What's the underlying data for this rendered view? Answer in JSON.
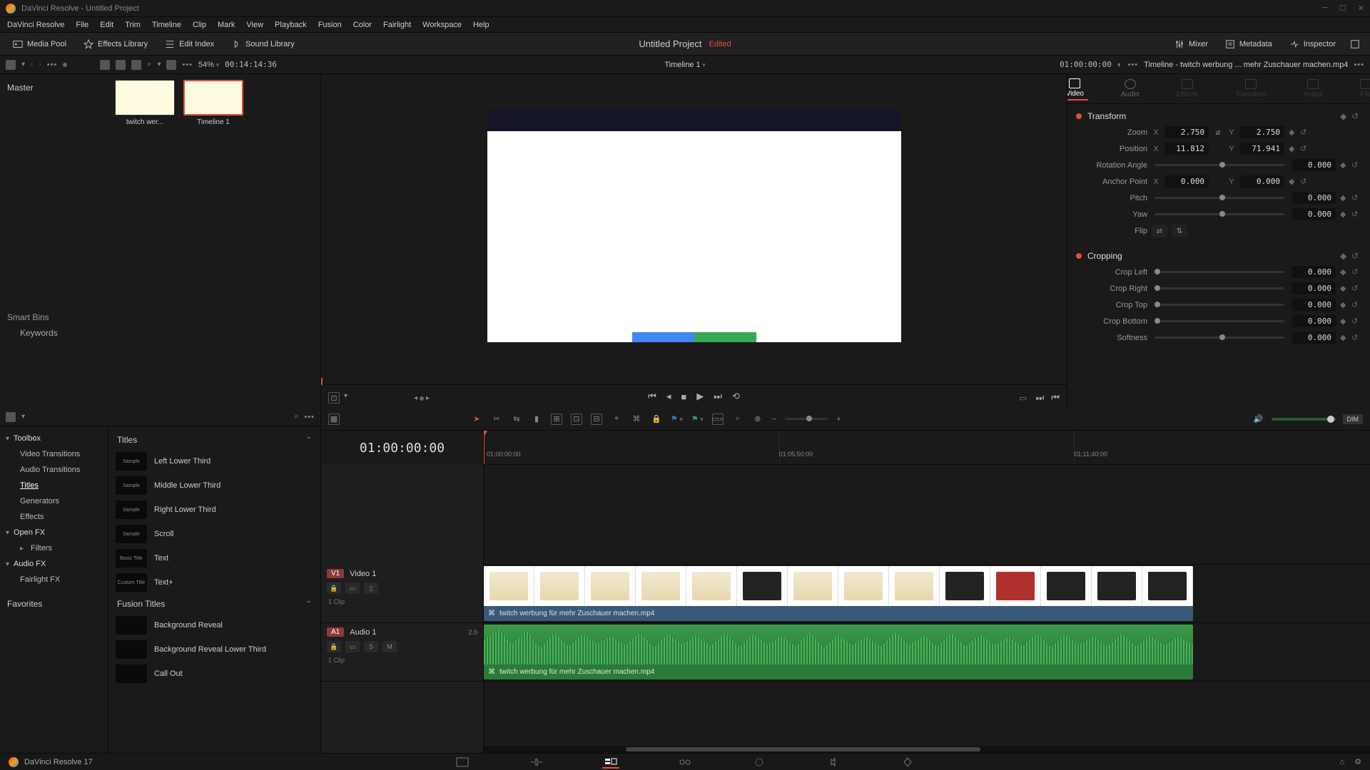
{
  "titlebar": {
    "text": "DaVinci Resolve - Untitled Project"
  },
  "menubar": [
    "DaVinci Resolve",
    "File",
    "Edit",
    "Trim",
    "Timeline",
    "Clip",
    "Mark",
    "View",
    "Playback",
    "Fusion",
    "Color",
    "Fairlight",
    "Workspace",
    "Help"
  ],
  "toolbar": {
    "media_pool": "Media Pool",
    "effects_library": "Effects Library",
    "edit_index": "Edit Index",
    "sound_library": "Sound Library",
    "project_title": "Untitled Project",
    "edited": "Edited",
    "mixer": "Mixer",
    "metadata": "Metadata",
    "inspector": "Inspector"
  },
  "subtoolbar": {
    "zoom_pct": "54%",
    "src_timecode": "00:14:14:36",
    "timeline_name": "Timeline 1",
    "record_timecode": "01:00:00:00",
    "clip_title": "Timeline - twitch werbung ... mehr Zuschauer machen.mp4"
  },
  "media": {
    "master": "Master",
    "smart_bins": "Smart Bins",
    "keywords": "Keywords",
    "thumbs": [
      {
        "label": "twitch wer..."
      },
      {
        "label": "Timeline 1"
      }
    ]
  },
  "inspector": {
    "tabs": [
      "Video",
      "Audio",
      "Effects",
      "Transition",
      "Image",
      "File"
    ],
    "transform": {
      "title": "Transform",
      "zoom_label": "Zoom",
      "zoom_x": "2.750",
      "zoom_y": "2.750",
      "position_label": "Position",
      "pos_x": "11.812",
      "pos_y": "71.941",
      "rotation_label": "Rotation Angle",
      "rotation": "0.000",
      "anchor_label": "Anchor Point",
      "anchor_x": "0.000",
      "anchor_y": "0.000",
      "pitch_label": "Pitch",
      "pitch": "0.000",
      "yaw_label": "Yaw",
      "yaw": "0.000",
      "flip_label": "Flip"
    },
    "cropping": {
      "title": "Cropping",
      "left_label": "Crop Left",
      "left": "0.000",
      "right_label": "Crop Right",
      "right": "0.000",
      "top_label": "Crop Top",
      "top": "0.000",
      "bottom_label": "Crop Bottom",
      "bottom": "0.000",
      "softness_label": "Softness",
      "softness": "0.000"
    }
  },
  "effects": {
    "nav": {
      "toolbox": "Toolbox",
      "video_transitions": "Video Transitions",
      "audio_transitions": "Audio Transitions",
      "titles": "Titles",
      "generators": "Generators",
      "effects": "Effects",
      "open_fx": "Open FX",
      "filters": "Filters",
      "audio_fx": "Audio FX",
      "fairlight_fx": "Fairlight FX",
      "favorites": "Favorites"
    },
    "titles_header": "Titles",
    "titles_list": [
      "Left Lower Third",
      "Middle Lower Third",
      "Right Lower Third",
      "Scroll",
      "Text",
      "Text+"
    ],
    "fusion_header": "Fusion Titles",
    "fusion_list": [
      "Background Reveal",
      "Background Reveal Lower Third",
      "Call Out"
    ]
  },
  "timeline": {
    "playhead_timecode": "01:00:00:00",
    "ruler": [
      "01:00:00:00",
      "01:05:50:00",
      "01:11:40:00"
    ],
    "video_track": {
      "badge": "V1",
      "name": "Video 1",
      "meta": "1 Clip"
    },
    "audio_track": {
      "badge": "A1",
      "name": "Audio 1",
      "meta": "1 Clip",
      "channels": "2.0",
      "solo": "S",
      "mute": "M"
    },
    "clip_name": "twitch werbung für mehr Zuschauer machen.mp4",
    "dim": "DIM"
  },
  "pagebar": {
    "version": "DaVinci Resolve 17"
  }
}
